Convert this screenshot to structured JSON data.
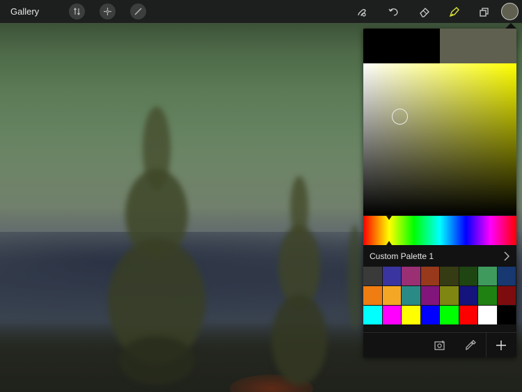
{
  "topbar": {
    "gallery_label": "Gallery",
    "left_tools": [
      "adjustments-icon",
      "selection-icon",
      "transform-icon"
    ],
    "right_tools": [
      "smudge-icon",
      "undo-icon",
      "eraser-icon",
      "brush-icon",
      "layers-icon"
    ],
    "active_tool": "brush-icon",
    "active_color_label": "current color"
  },
  "colors": {
    "accent_active_tool": "#d9e23a",
    "previous_color": "#000000",
    "current_color": "#5f6050",
    "sv_hue": "#ffff00"
  },
  "color_panel": {
    "hue_position": 0.17,
    "sv_handle": {
      "saturation": 0.24,
      "value": 0.65
    },
    "palette_name": "Custom Palette 1",
    "swatches": [
      "#3a3a3a",
      "#3a34a1",
      "#9a2f74",
      "#97391a",
      "#353b13",
      "#1e4512",
      "#3f9a5e",
      "#173870",
      "#f07d12",
      "#f4a724",
      "#2a8a85",
      "#82157b",
      "#7f8611",
      "#15137c",
      "#208113",
      "#7d0c0f",
      "#00ffff",
      "#ff00ff",
      "#ffff00",
      "#0000ff",
      "#00ff00",
      "#ff0000",
      "#ffffff",
      "#000000"
    ],
    "toolbar": [
      "add-from-photo-icon",
      "eyedropper-icon",
      "add-swatch-icon"
    ]
  }
}
